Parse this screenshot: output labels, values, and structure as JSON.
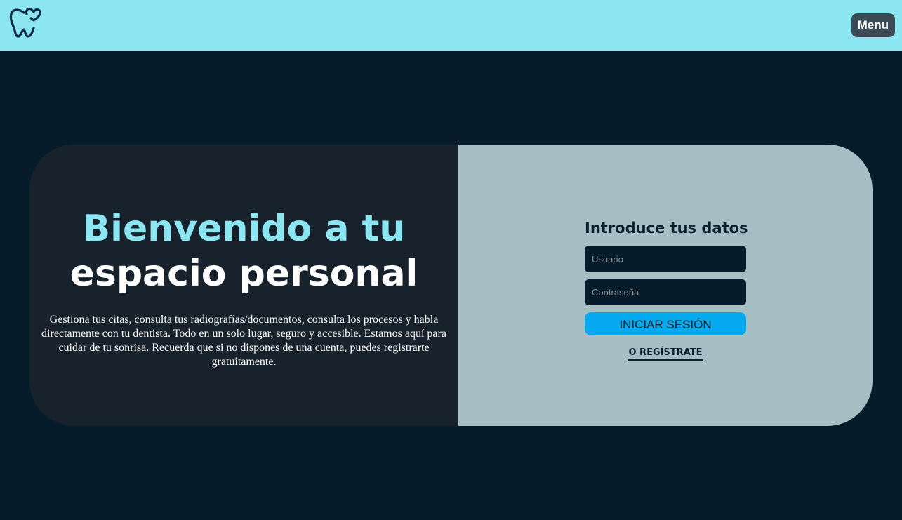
{
  "header": {
    "logo_icon": "tooth-heart-icon",
    "menu_label": "Menu"
  },
  "hero": {
    "title_line1": "Bienvenido a tu",
    "title_line2": "espacio personal",
    "description": "Gestiona tus citas, consulta tus radiografías/documentos, consulta los procesos y habla directamente con tu dentista. Todo en un solo lugar, seguro y accesible. Estamos aquí para cuidar de tu sonrisa. Recuerda que si no dispones de una cuenta, puedes registrarte gratuitamente."
  },
  "login": {
    "title": "Introduce tus datos",
    "username_placeholder": "Usuario",
    "username_value": "",
    "password_placeholder": "Contraseña",
    "password_value": "",
    "submit_label": "INICIAR SESIÓN",
    "register_label": "O REGÍSTRATE"
  },
  "colors": {
    "header_bg": "#8be6f2",
    "page_bg": "#071c2b",
    "card_left_bg": "#18222d",
    "card_right_bg": "#a5bfc4",
    "accent": "#8be6f2",
    "button_bg": "#05a9ef"
  }
}
